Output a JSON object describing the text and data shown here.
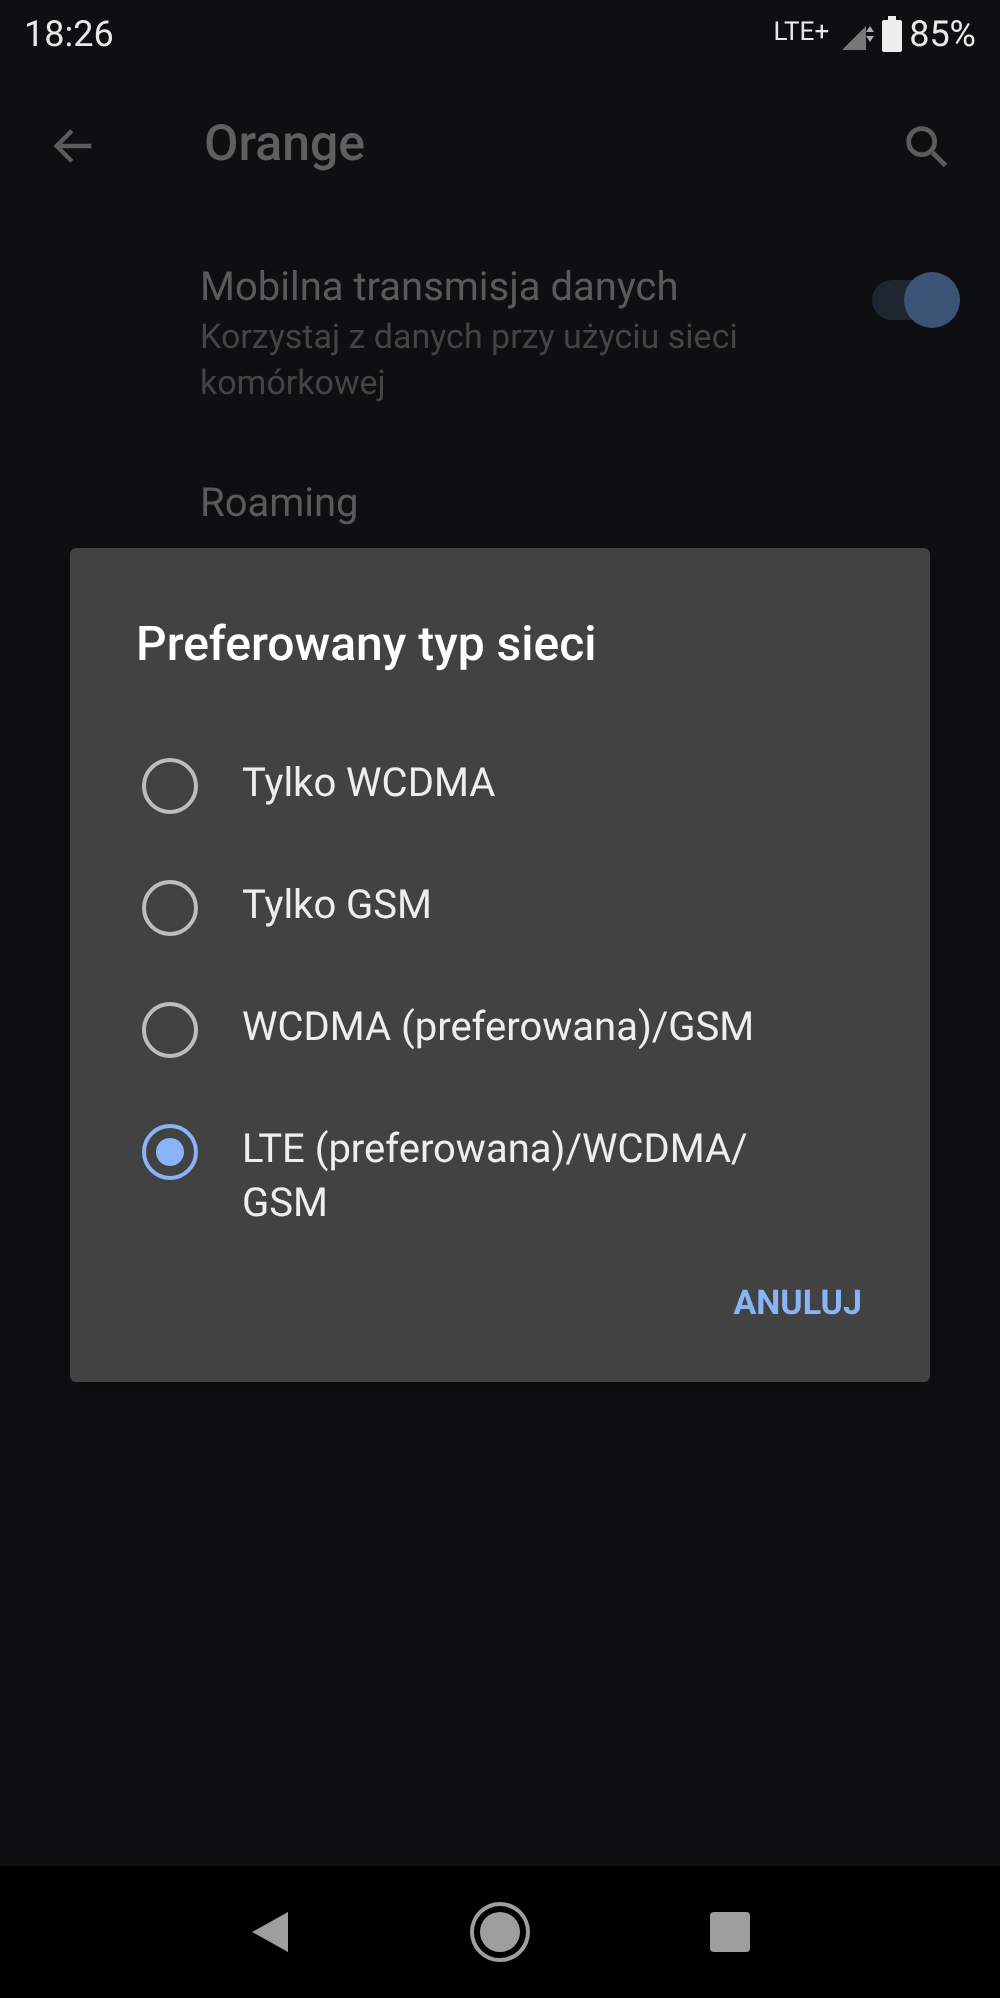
{
  "status_bar": {
    "time": "18:26",
    "network": "LTE+",
    "battery": "85%"
  },
  "toolbar": {
    "title": "Orange"
  },
  "settings": [
    {
      "title": "Mobilna transmisja danych",
      "subtitle": "Korzystaj z danych przy użyciu sieci komórkowej",
      "on": true
    },
    {
      "title": "Roaming"
    }
  ],
  "dialog": {
    "title": "Preferowany typ sieci",
    "options": [
      {
        "label": "Tylko WCDMA",
        "selected": false
      },
      {
        "label": "Tylko GSM",
        "selected": false
      },
      {
        "label": "WCDMA (preferowana)/GSM",
        "selected": false
      },
      {
        "label": "LTE (preferowana)/WCDMA/ GSM",
        "selected": true
      }
    ],
    "buttons": [
      "ANULUJ"
    ]
  }
}
